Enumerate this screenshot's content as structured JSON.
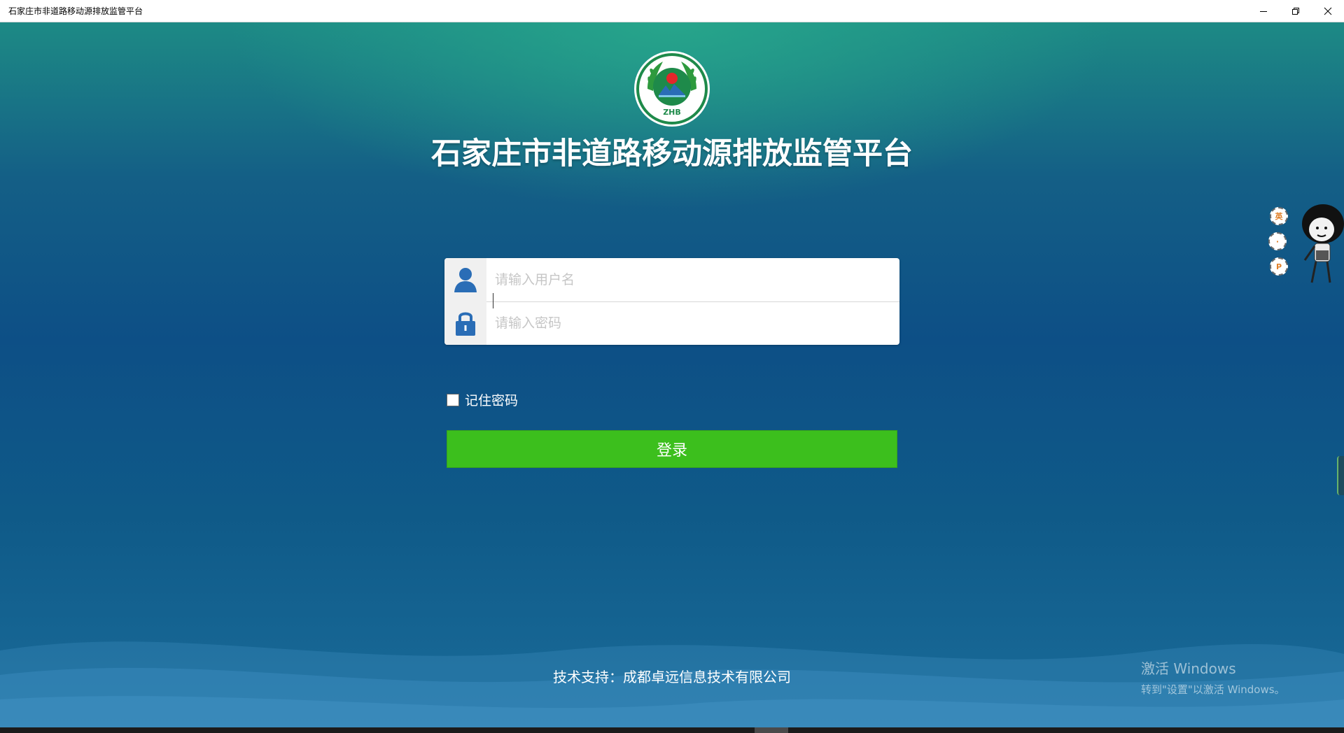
{
  "window": {
    "title": "石家庄市非道路移动源排放监管平台"
  },
  "logo": {
    "text": "ZHB"
  },
  "heading": "石家庄市非道路移动源排放监管平台",
  "login": {
    "username_placeholder": "请输入用户名",
    "password_placeholder": "请输入密码",
    "remember_label": "记住密码",
    "remember_checked": false,
    "submit_label": "登录"
  },
  "footer": "技术支持：成都卓远信息技术有限公司",
  "watermark": {
    "line1": "激活 Windows",
    "line2": "转到\"设置\"以激活 Windows。"
  },
  "side_widget": {
    "bubble1": "英",
    "bubble2": "·",
    "bubble3": "P"
  },
  "colors": {
    "accent_green": "#3cbf1d",
    "icon_blue": "#2a6db6",
    "bg_teal": "#1d8a85",
    "bg_blue": "#0d4f86"
  }
}
